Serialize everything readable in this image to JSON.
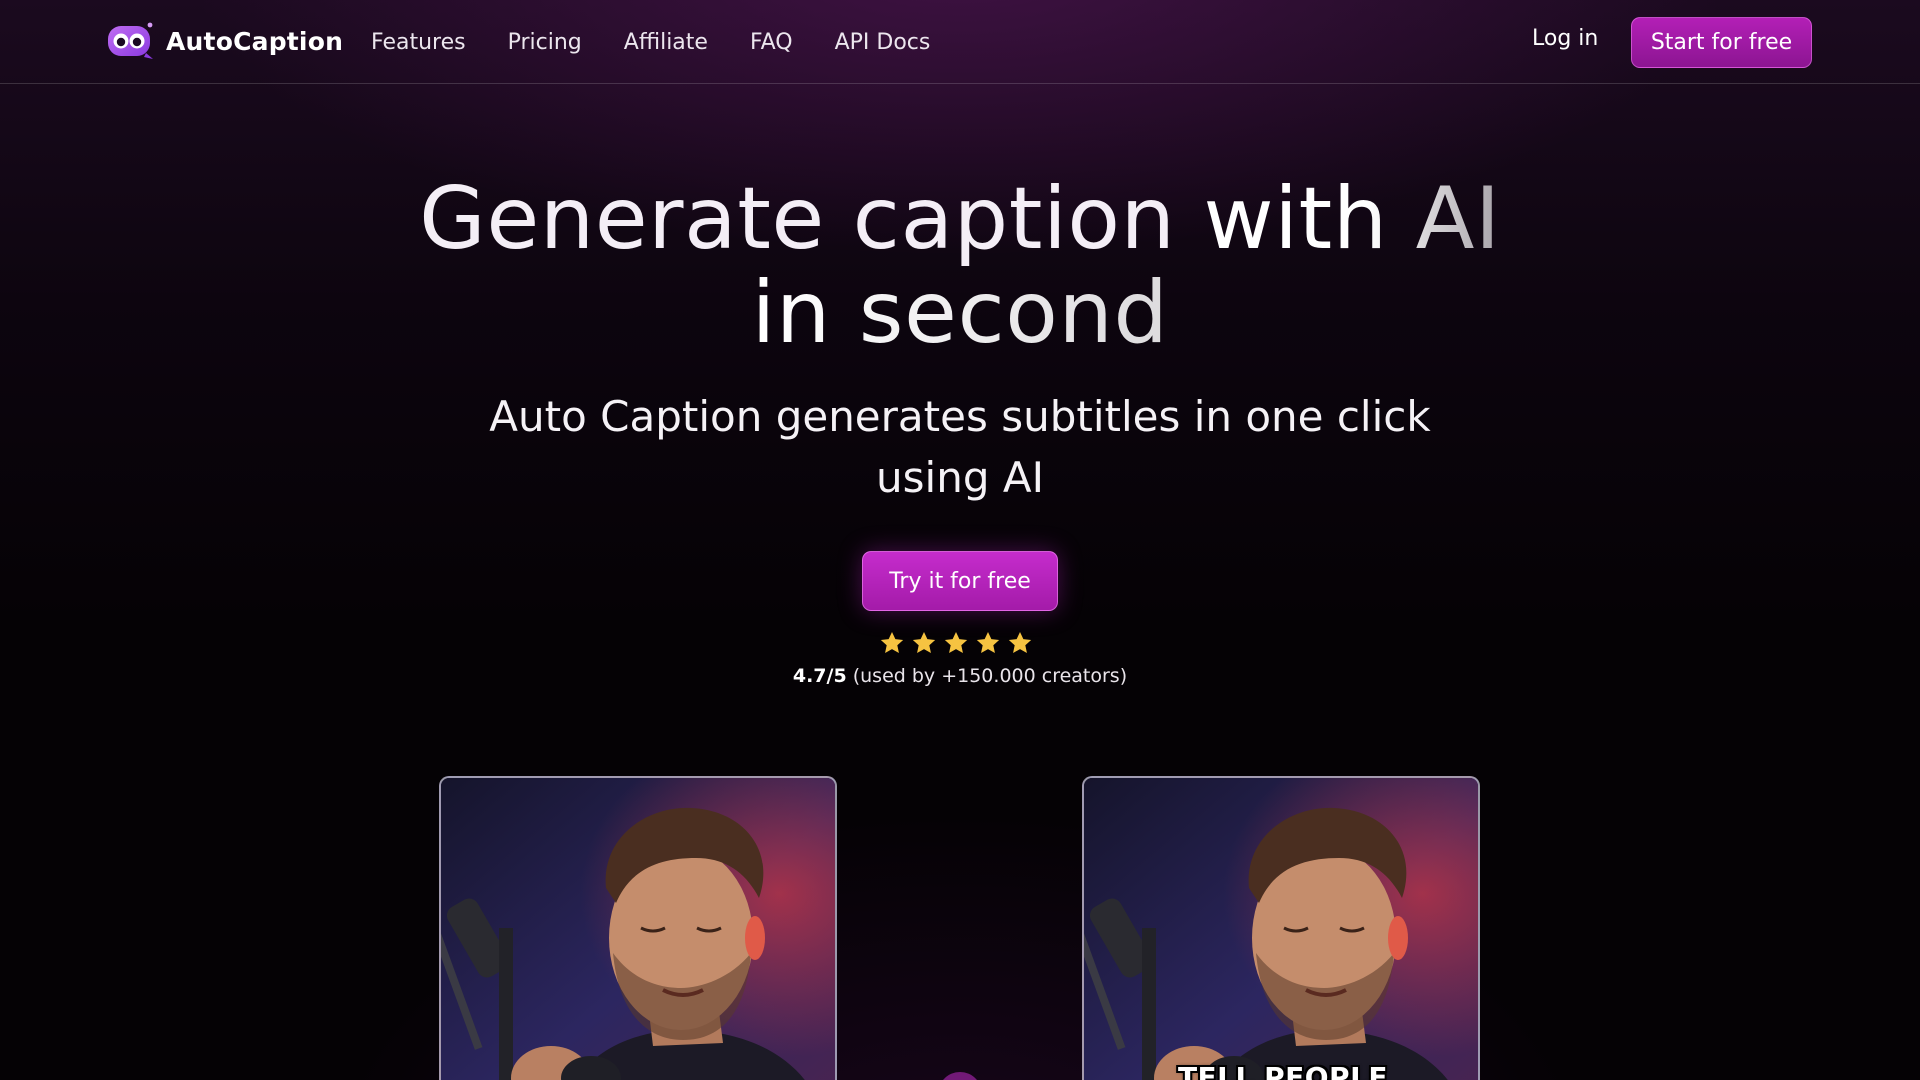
{
  "header": {
    "brand": "AutoCaption",
    "nav": [
      "Features",
      "Pricing",
      "Affiliate",
      "FAQ",
      "API Docs"
    ],
    "login_label": "Log in",
    "start_label": "Start for free"
  },
  "hero": {
    "title_line1_a": "Generate caption ",
    "title_line1_b": "with AI",
    "title_line2": "in second",
    "subtitle": "Auto Caption generates subtitles in one click using AI",
    "cta_label": "Try it for free",
    "rating_value": 5,
    "rating_score": "4.7/5",
    "rating_text": " (used by +150.000 creators)"
  },
  "preview": {
    "right_caption": "TELL PEOPLE"
  },
  "colors": {
    "accent": "#b31fb6",
    "star": "#f6c341",
    "background": "#050205"
  },
  "icons": {
    "logo": "robot-face-icon",
    "star": "star-icon"
  }
}
